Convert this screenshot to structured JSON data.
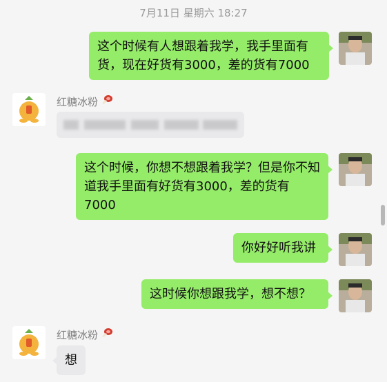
{
  "timestamp": "7月11日 星期六 18:27",
  "contact": {
    "name": "红糖冰粉"
  },
  "messages": [
    {
      "side": "right",
      "text": "这个时候有人想跟着我学，我手里面有货，现在好货有3000，差的货有7000"
    },
    {
      "side": "left",
      "text": ""
    },
    {
      "side": "right",
      "text": "这个时候，你想不想跟着我学？但是你不知道我手里面有好货有3000，差的货有7000"
    },
    {
      "side": "right",
      "text": "你好好听我讲"
    },
    {
      "side": "right",
      "text": "这时候你想跟我学，想不想？"
    },
    {
      "side": "left",
      "text": "想"
    }
  ],
  "icons": {
    "sender_badge": "meat-icon"
  },
  "colors": {
    "outgoing_bubble": "#95ec69",
    "incoming_bubble": "#e9e9eb",
    "background": "#f5f5f5"
  }
}
